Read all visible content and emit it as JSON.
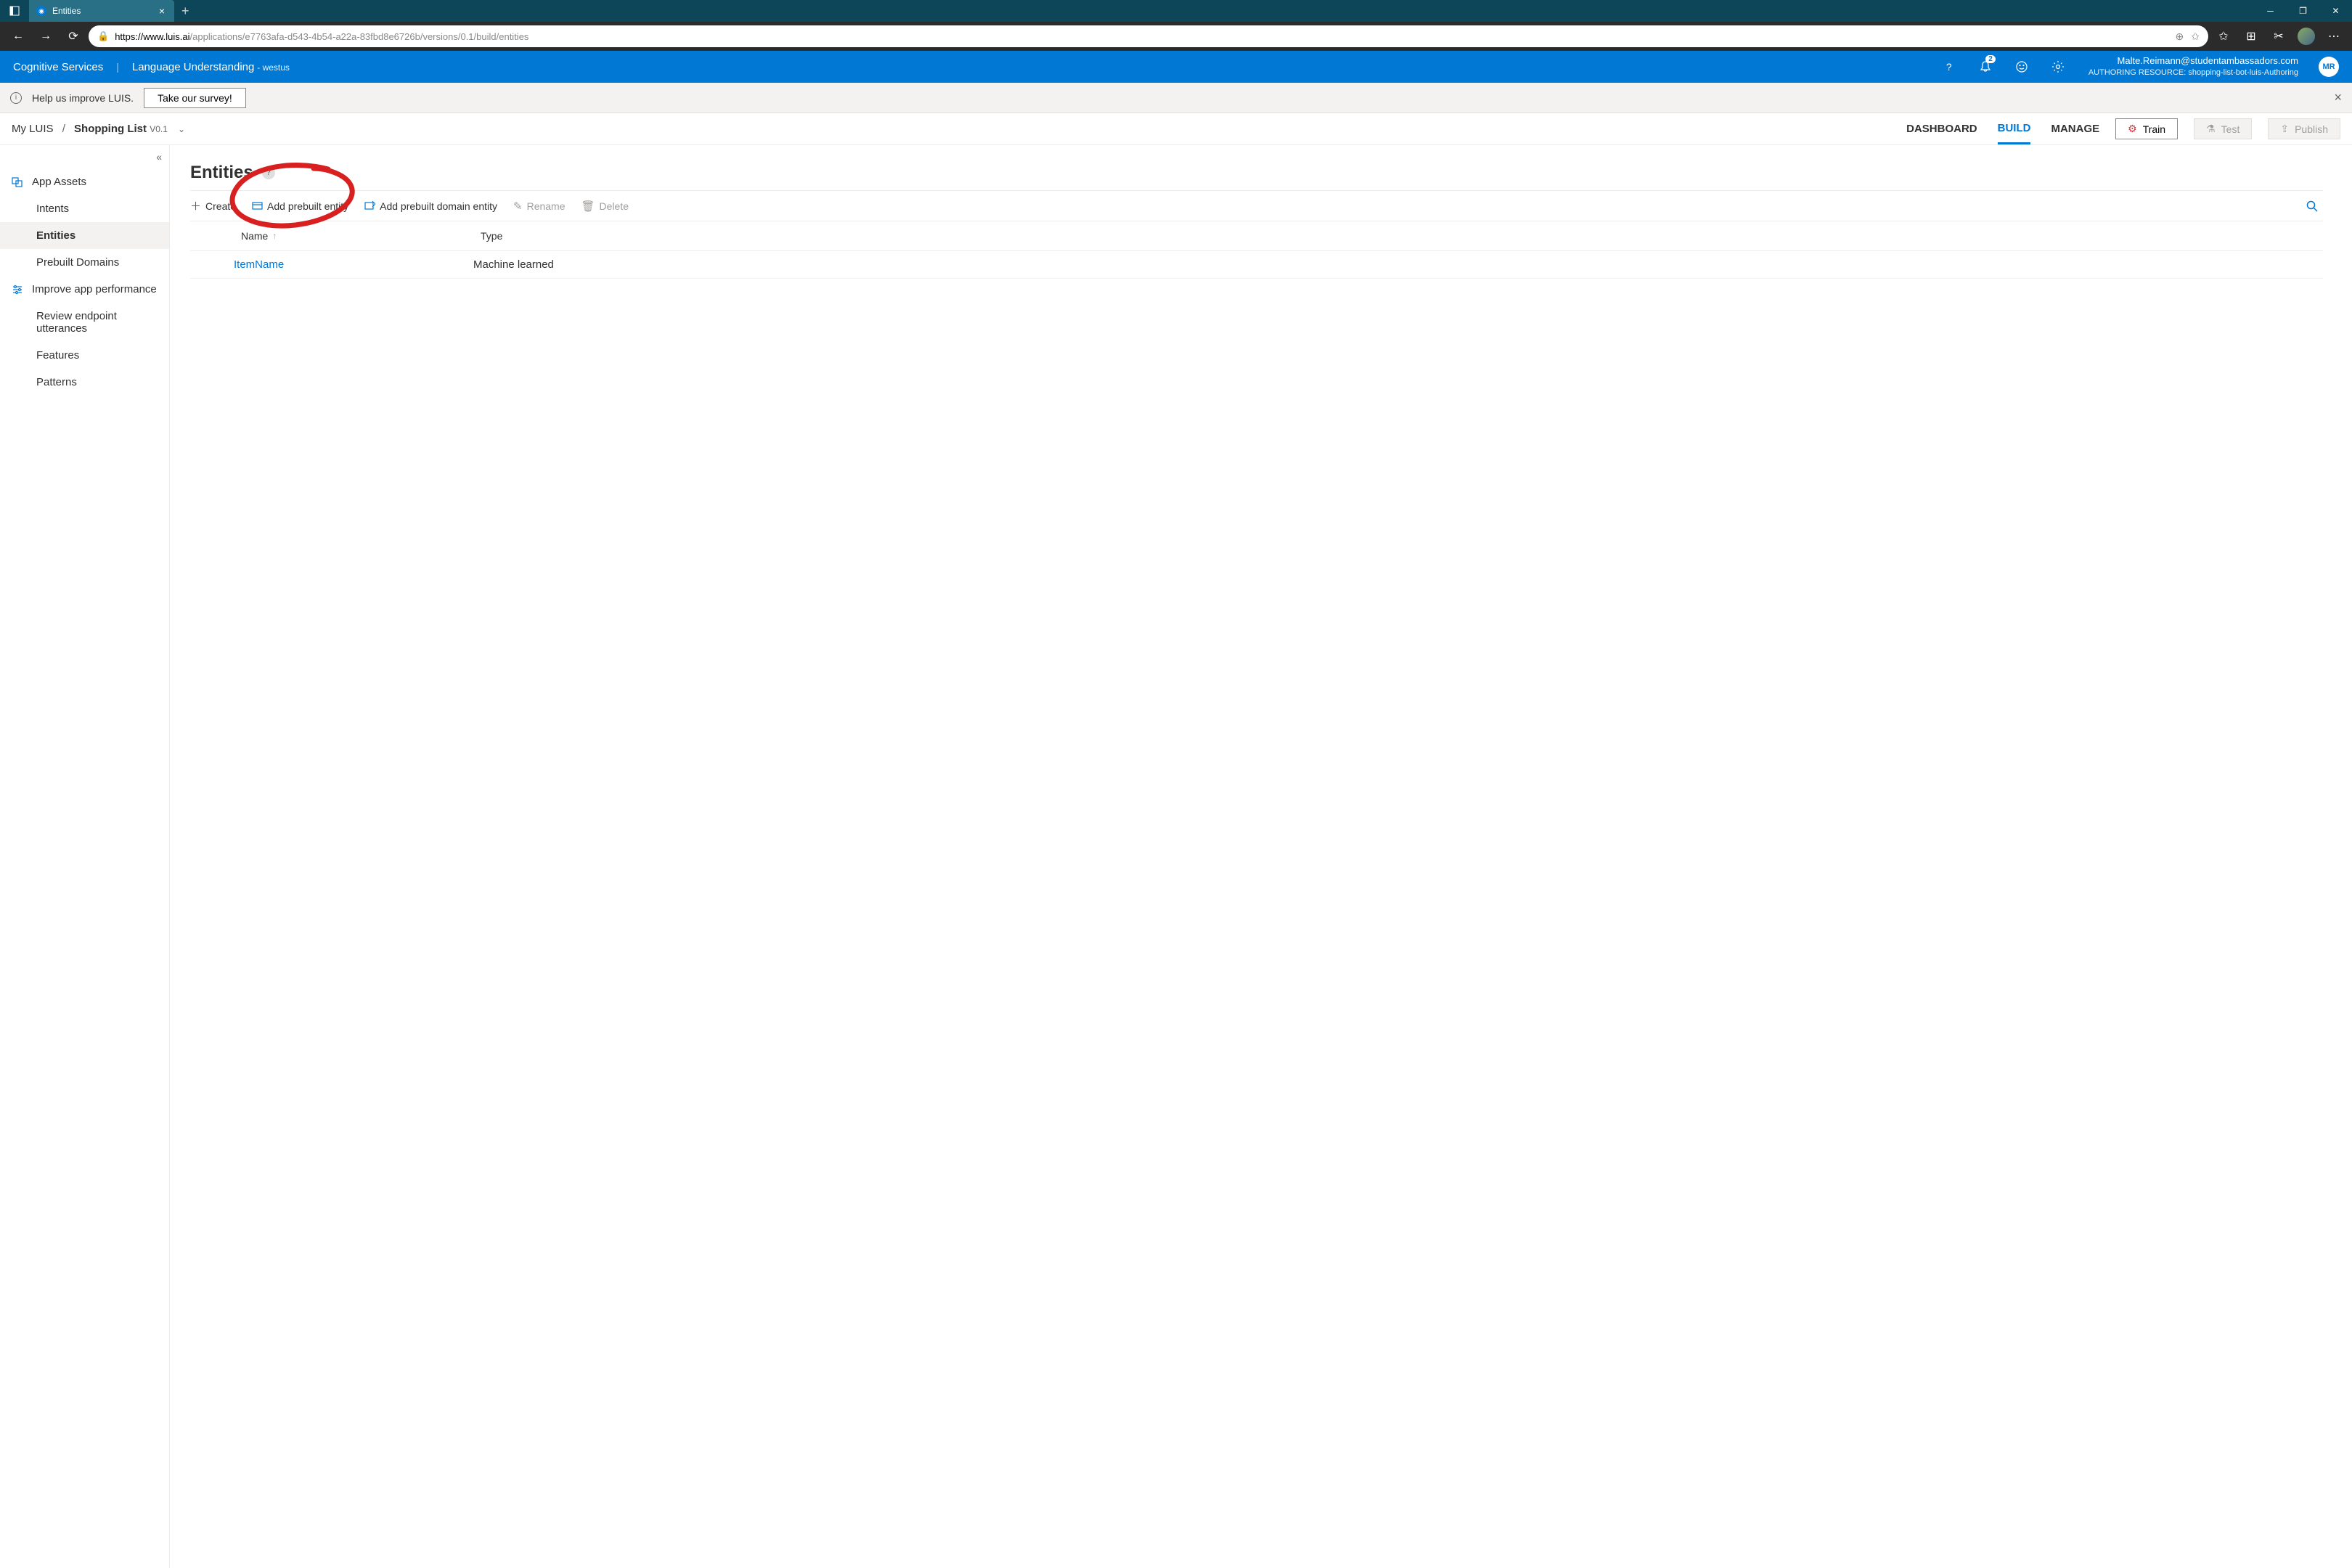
{
  "browser": {
    "tab_title": "Entities",
    "url_domain": "https://www.luis.ai",
    "url_path": "/applications/e7763afa-d543-4b54-a22a-83fbd8e6726b/versions/0.1/build/entities"
  },
  "header": {
    "brand": "Cognitive Services",
    "product": "Language Understanding",
    "region": "- westus",
    "notification_count": "2",
    "user_email": "Malte.Reimann@studentambassadors.com",
    "resource_label": "AUTHORING RESOURCE:",
    "resource_value": "shopping-list-bot-luis-Authoring",
    "user_initials": "MR"
  },
  "banner": {
    "text": "Help us improve LUIS.",
    "button": "Take our survey!"
  },
  "breadcrumb": {
    "root": "My LUIS",
    "app": "Shopping List",
    "version": "V0.1"
  },
  "toptabs": {
    "dashboard": "DASHBOARD",
    "build": "BUILD",
    "manage": "MANAGE"
  },
  "actions": {
    "train": "Train",
    "test": "Test",
    "publish": "Publish"
  },
  "sidebar": {
    "group_app_assets": "App Assets",
    "intents": "Intents",
    "entities": "Entities",
    "prebuilt": "Prebuilt Domains",
    "group_improve": "Improve app performance",
    "review": "Review endpoint utterances",
    "features": "Features",
    "patterns": "Patterns"
  },
  "page": {
    "title": "Entities",
    "toolbar": {
      "create": "Create",
      "add_prebuilt": "Add prebuilt entity",
      "add_domain": "Add prebuilt domain entity",
      "rename": "Rename",
      "delete": "Delete"
    },
    "columns": {
      "name": "Name",
      "type": "Type"
    },
    "rows": [
      {
        "name": "ItemName",
        "type": "Machine learned"
      }
    ]
  }
}
